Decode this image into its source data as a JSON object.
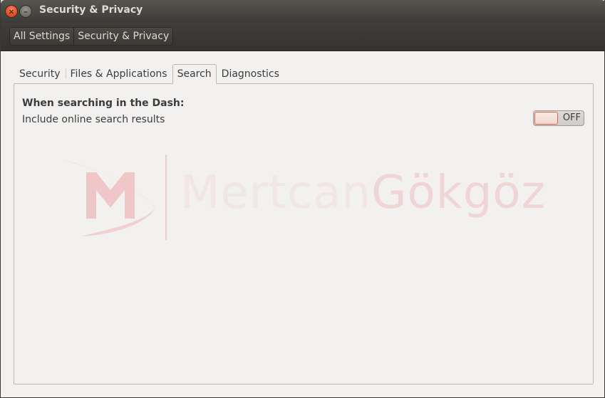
{
  "window": {
    "title": "Security & Privacy"
  },
  "toolbar": {
    "breadcrumbs": [
      "All Settings",
      "Security & Privacy"
    ]
  },
  "tabs": [
    {
      "label": "Security",
      "active": false
    },
    {
      "label": "Files & Applications",
      "active": false
    },
    {
      "label": "Search",
      "active": true
    },
    {
      "label": "Diagnostics",
      "active": false
    }
  ],
  "search": {
    "heading": "When searching in the Dash:",
    "online_results_label": "Include online search results",
    "online_results_state": "OFF"
  },
  "watermark": {
    "first": "Mertcan",
    "last": "Gökgöz"
  },
  "colors": {
    "titlebar": "#3d3b37",
    "close_button": "#e2511f",
    "switch_accent": "#d8684a",
    "window_bg": "#f2f1f0"
  }
}
